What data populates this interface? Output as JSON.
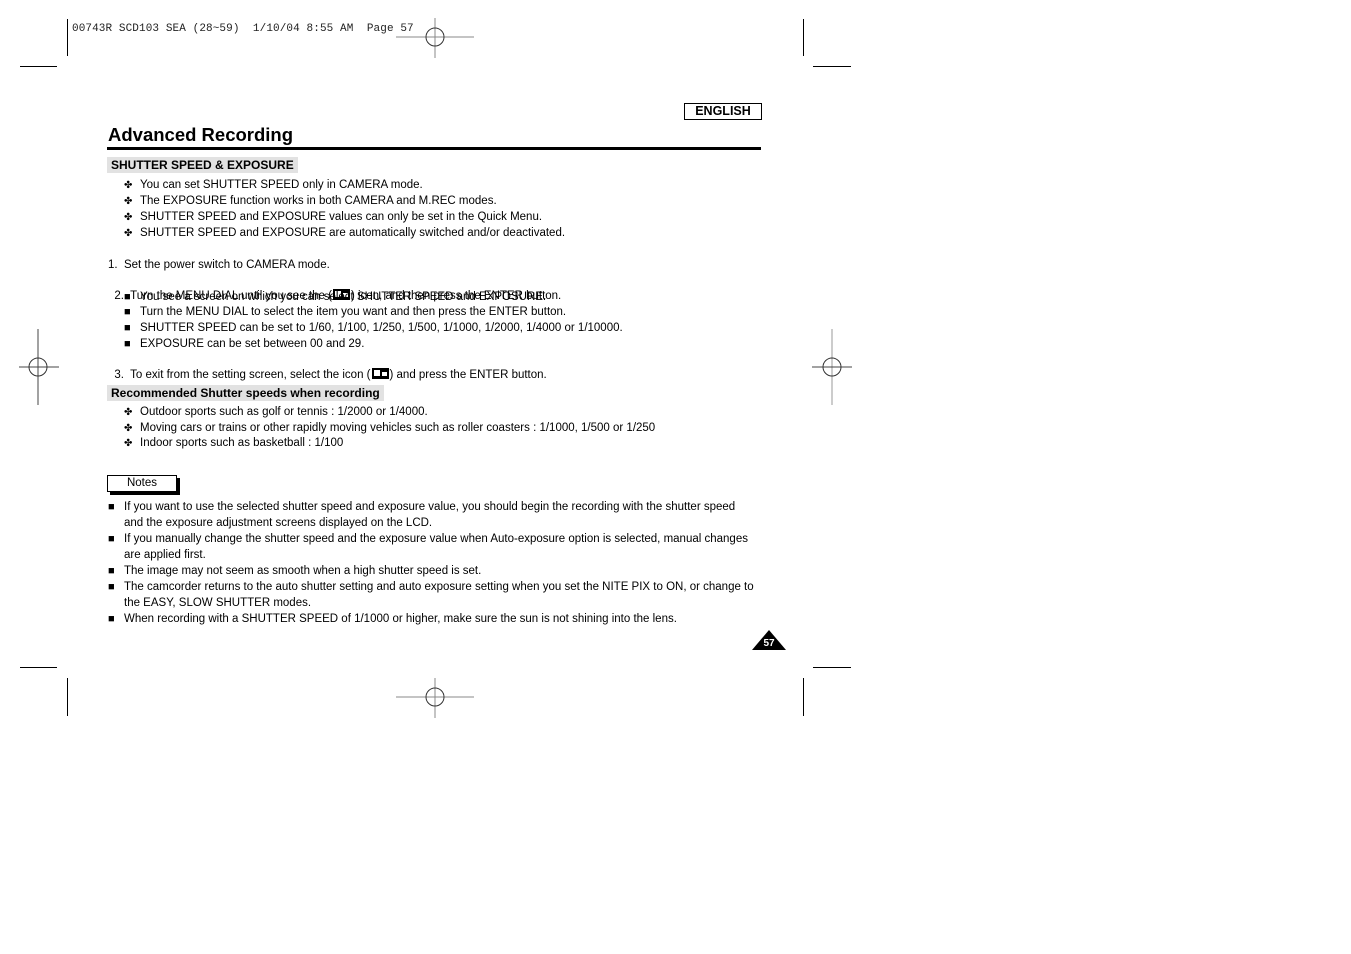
{
  "print_header": "00743R SCD103 SEA (28~59)  1/10/04 8:55 AM  Page 57",
  "language_badge": "ENGLISH",
  "page_title": "Advanced Recording",
  "section1": {
    "heading": "SHUTTER SPEED & EXPOSURE",
    "bullet_icon": "cross-bullet-icon",
    "bullets": [
      "You can set SHUTTER SPEED only in CAMERA mode.",
      "The EXPOSURE function works in both CAMERA and M.REC modes.",
      "SHUTTER SPEED and EXPOSURE values can only be set in the Quick Menu.",
      "SHUTTER SPEED and EXPOSURE are automatically switched and/or deactivated."
    ]
  },
  "steps": {
    "step1": "1.  Set the power switch to CAMERA mode.",
    "step2_pre": "2.  Turn the MENU DIAL until you see the (",
    "step2_post": ") icon, and then press the ENTER button.",
    "step2_icon": "menu-quick-icon",
    "sub_bullets": [
      "You see a screen on which you can select SHUTTER SPEED and EXPOSURE.",
      "Turn the MENU DIAL to select the item you want and then press the ENTER button.",
      "SHUTTER SPEED can be set to 1/60, 1/100, 1/250, 1/500, 1/1000, 1/2000, 1/4000 or 1/10000.",
      "EXPOSURE can be set between 00 and 29."
    ],
    "step3_pre": "3.  To exit from the setting screen, select the icon (",
    "step3_post": ") and press the ENTER button."
  },
  "section2": {
    "heading": "Recommended Shutter speeds when recording",
    "bullets": [
      "Outdoor sports such as golf or tennis : 1/2000 or 1/4000.",
      "Moving cars or trains or other rapidly moving vehicles such as roller coasters : 1/1000, 1/500 or 1/250",
      "Indoor sports such as basketball : 1/100"
    ]
  },
  "notes": {
    "label": "Notes",
    "lines": [
      {
        "bullet": true,
        "text": "If you want to use the selected shutter speed and exposure value, you should begin the recording with the shutter speed"
      },
      {
        "bullet": false,
        "text": "and the exposure adjustment screens displayed on the LCD."
      },
      {
        "bullet": true,
        "text": "If you manually change the shutter speed and the exposure value when Auto-exposure option is selected, manual changes"
      },
      {
        "bullet": false,
        "text": "are applied first."
      },
      {
        "bullet": true,
        "text": "The image may not seem as smooth when a high shutter speed is set."
      },
      {
        "bullet": true,
        "text": "The camcorder returns to the auto shutter setting and auto exposure setting when you set the NITE PIX to ON, or change to"
      },
      {
        "bullet": false,
        "text": "the EASY, SLOW SHUTTER modes."
      },
      {
        "bullet": true,
        "text": "When recording with a SHUTTER SPEED of 1/1000 or higher, make sure the sun is not shining into the lens."
      }
    ]
  },
  "glyphs": {
    "cross": "✤",
    "square": "■"
  },
  "page_number": "57"
}
